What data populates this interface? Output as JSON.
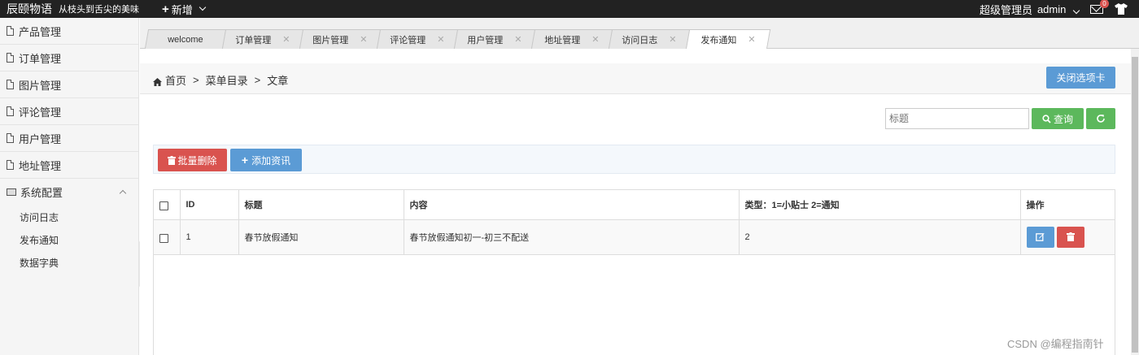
{
  "header": {
    "brand": "辰颐物语",
    "slogan": "从枝头到舌尖的美味",
    "new_label": "新增",
    "role": "超级管理员",
    "username": "admin",
    "mail_badge": "0"
  },
  "sidebar": {
    "items": [
      {
        "label": "产品管理"
      },
      {
        "label": "订单管理"
      },
      {
        "label": "图片管理"
      },
      {
        "label": "评论管理"
      },
      {
        "label": "用户管理"
      },
      {
        "label": "地址管理"
      }
    ],
    "config_group": {
      "label": "系统配置",
      "children": [
        {
          "label": "访问日志"
        },
        {
          "label": "发布通知"
        },
        {
          "label": "数据字典"
        }
      ]
    }
  },
  "tabs": [
    {
      "label": "welcome"
    },
    {
      "label": "订单管理"
    },
    {
      "label": "图片管理"
    },
    {
      "label": "评论管理"
    },
    {
      "label": "用户管理"
    },
    {
      "label": "地址管理"
    },
    {
      "label": "访问日志"
    },
    {
      "label": "发布通知",
      "active": true
    }
  ],
  "breadcrumb": {
    "home": "首页",
    "sep": ">",
    "level1": "菜单目录",
    "level2": "文章"
  },
  "close_tabs_label": "关闭选项卡",
  "search": {
    "placeholder": "标题",
    "button_label": "查询"
  },
  "actions": {
    "batch_delete_label": "批量删除",
    "add_label": "添加资讯"
  },
  "table": {
    "columns": [
      "ID",
      "标题",
      "内容",
      "类型：1=小贴士 2=通知",
      "操作"
    ],
    "rows": [
      {
        "id": "1",
        "title": "春节放假通知",
        "content": "春节放假通知初一-初三不配送",
        "type": "2"
      }
    ]
  },
  "watermark": "CSDN @编程指南针",
  "colors": {
    "topbar": "#222222",
    "primary": "#5b9bd5",
    "success": "#5cb85c",
    "danger": "#d9534f"
  }
}
